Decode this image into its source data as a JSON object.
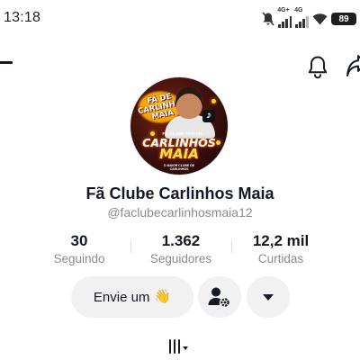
{
  "status_bar": {
    "time": "13:18",
    "network_1": "4G+",
    "network_2": "4G",
    "battery": "89"
  },
  "icons": {
    "back": "arrow-left-icon",
    "notifications": "bell-icon",
    "share": "share-icon",
    "follow_options": "person-gear-icon",
    "more": "caret-down-icon",
    "videos_tab": "grid-icon"
  },
  "profile": {
    "avatar_text": {
      "top": "FÃ DE CARLINHOS MAIA",
      "sub": "FÃ CLUBE OFICIAL",
      "name_1": "CARLINHOS",
      "name_2": "MAIA",
      "footer": "O MAIOR CLUBE DE CARLINHOS"
    },
    "display_name": "Fã Clube Carlinhos Maia",
    "username": "@faclubecarlinhosmaia12"
  },
  "stats": [
    {
      "value": "30",
      "label": "Seguindo"
    },
    {
      "value": "1.362",
      "label": "Seguidores"
    },
    {
      "value": "12,2 mil",
      "label": "Curtidas"
    }
  ],
  "actions": {
    "message_label": "Envie um",
    "message_emoji": "👋"
  },
  "colors": {
    "text_primary": "#161823",
    "text_secondary": "#8a8b91",
    "button_bg": "#f1f1f2"
  }
}
